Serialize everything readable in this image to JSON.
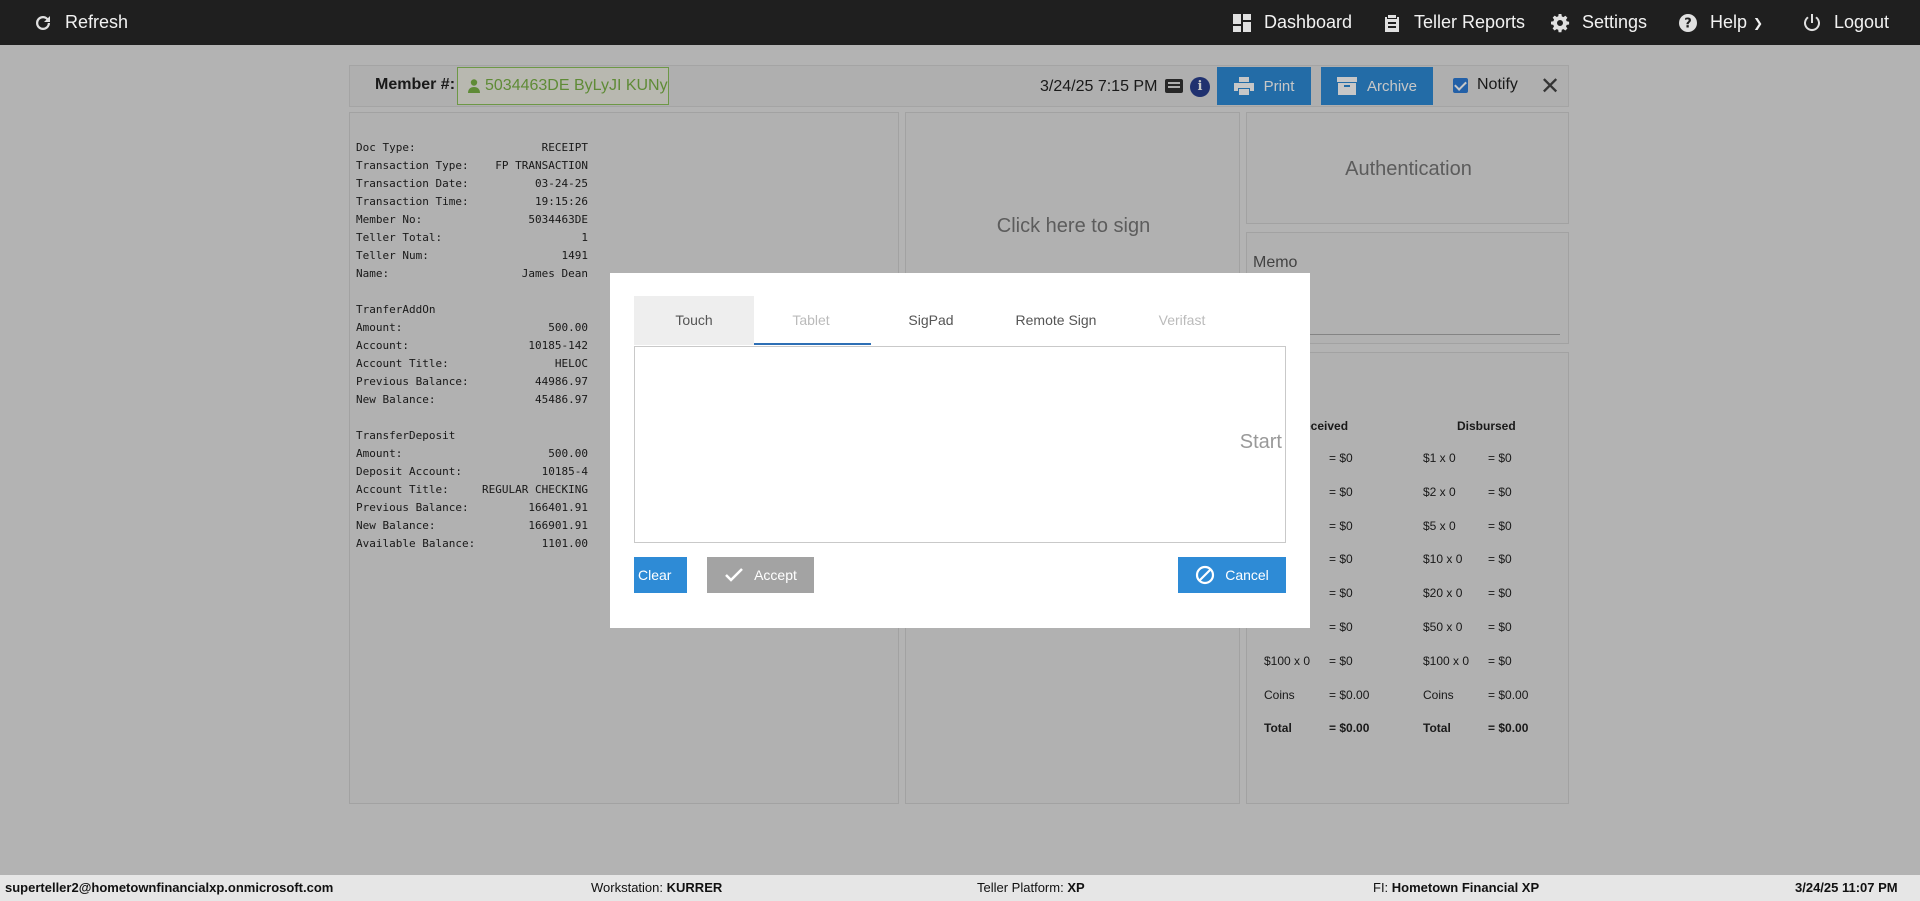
{
  "nav": {
    "refresh": "Refresh",
    "dashboard": "Dashboard",
    "teller_reports": "Teller Reports",
    "settings": "Settings",
    "help": "Help",
    "logout": "Logout"
  },
  "member_bar": {
    "label": "Member #:",
    "member_value": "5034463DE ByLyJI KUNy",
    "datetime": "3/24/25 7:15 PM",
    "print": "Print",
    "archive": "Archive",
    "notify": "Notify",
    "notify_checked": true,
    "close": "✕"
  },
  "receipt": {
    "rows": [
      {
        "k": "Doc Type:",
        "v": "RECEIPT"
      },
      {
        "k": "Transaction Type:",
        "v": "FP TRANSACTION"
      },
      {
        "k": "Transaction Date:",
        "v": "03-24-25"
      },
      {
        "k": "Transaction Time:",
        "v": "19:15:26"
      },
      {
        "k": "Member No:",
        "v": "5034463DE"
      },
      {
        "k": "Teller Total:",
        "v": "1"
      },
      {
        "k": "Teller Num:",
        "v": "1491"
      },
      {
        "k": "Name:",
        "v": "James Dean"
      },
      {
        "k": "",
        "v": ""
      },
      {
        "k": "TranferAddOn",
        "v": ""
      },
      {
        "k": "Amount:",
        "v": "500.00"
      },
      {
        "k": "Account:",
        "v": "10185-142"
      },
      {
        "k": "Account Title:",
        "v": "HELOC"
      },
      {
        "k": "Previous Balance:",
        "v": "44986.97"
      },
      {
        "k": "New Balance:",
        "v": "45486.97"
      },
      {
        "k": "",
        "v": ""
      },
      {
        "k": "TransferDeposit",
        "v": ""
      },
      {
        "k": "Amount:",
        "v": "500.00"
      },
      {
        "k": "Deposit Account:",
        "v": "10185-4"
      },
      {
        "k": "Account Title:",
        "v": "REGULAR CHECKING"
      },
      {
        "k": "Previous Balance:",
        "v": "166401.91"
      },
      {
        "k": "New Balance:",
        "v": "166901.91"
      },
      {
        "k": "Available Balance:",
        "v": "1101.00"
      }
    ]
  },
  "sign_panel": {
    "click_to_sign": "Click here to sign"
  },
  "auth_panel": {
    "label": "Authentication"
  },
  "memo_panel": {
    "label": "Memo"
  },
  "cash": {
    "received_header": "eceived",
    "disbursed_header": "Disbursed",
    "received": [
      {
        "denom": "",
        "amount": "= $0"
      },
      {
        "denom": "",
        "amount": "= $0"
      },
      {
        "denom": "",
        "amount": "= $0"
      },
      {
        "denom": "",
        "amount": "= $0"
      },
      {
        "denom": "",
        "amount": "= $0"
      },
      {
        "denom": "",
        "amount": "= $0"
      },
      {
        "denom": "$100 x 0",
        "amount": "= $0"
      },
      {
        "denom": "Coins",
        "amount": "= $0.00"
      },
      {
        "denom": "Total",
        "amount": "= $0.00"
      }
    ],
    "disbursed": [
      {
        "denom": "$1 x 0",
        "amount": "= $0"
      },
      {
        "denom": "$2 x 0",
        "amount": "= $0"
      },
      {
        "denom": "$5 x 0",
        "amount": "= $0"
      },
      {
        "denom": "$10 x 0",
        "amount": "= $0"
      },
      {
        "denom": "$20 x 0",
        "amount": "= $0"
      },
      {
        "denom": "$50 x 0",
        "amount": "= $0"
      },
      {
        "denom": "$100 x 0",
        "amount": "= $0"
      },
      {
        "denom": "Coins",
        "amount": "= $0.00"
      },
      {
        "denom": "Total",
        "amount": "= $0.00"
      }
    ]
  },
  "modal": {
    "tabs": [
      {
        "label": "Touch",
        "state": "active"
      },
      {
        "label": "Tablet",
        "state": "disabled"
      },
      {
        "label": "SigPad",
        "state": "normal"
      },
      {
        "label": "Remote Sign",
        "state": "normal"
      },
      {
        "label": "Verifast",
        "state": "disabled"
      }
    ],
    "start_text": "Start",
    "clear": "Clear",
    "accept": "Accept",
    "cancel": "Cancel"
  },
  "status": {
    "user": "superteller2@hometownfinancialxp.onmicrosoft.com",
    "workstation_label": "Workstation:",
    "workstation": "KURRER",
    "platform_label": "Teller Platform:",
    "platform": "XP",
    "fi_label": "FI:",
    "fi": "Hometown Financial XP",
    "datetime": "3/24/25 11:07 PM"
  },
  "colors": {
    "topbar": "#1f1f1f",
    "primary_blue": "#2e8bd6",
    "member_green": "#7ab346",
    "accept_gray": "#a3a3a3"
  }
}
